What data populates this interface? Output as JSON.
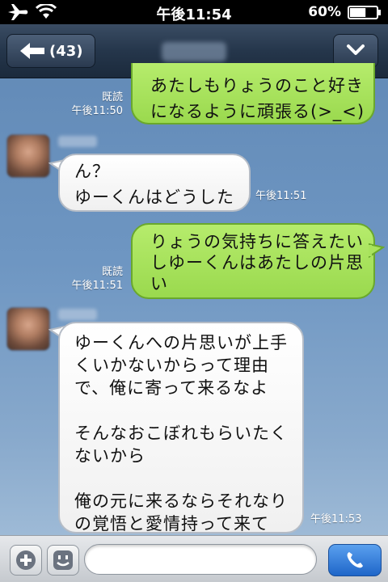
{
  "status_bar": {
    "time": "午後11:54",
    "battery_percent": "60%",
    "battery_level": 0.6
  },
  "nav": {
    "back_label": "(43)"
  },
  "messages": [
    {
      "side": "right",
      "lines": [
        "あたしもりょうのこと好き",
        "になるように頑張る(>_<)"
      ],
      "read": "既読",
      "time": "午後11:50"
    },
    {
      "side": "left",
      "lines": [
        "ん？",
        "ゆーくんはどうした"
      ],
      "time": "午後11:51"
    },
    {
      "side": "right",
      "lines": [
        "りょうの気持ちに答えたい",
        "しゆーくんはあたしの片思",
        "い"
      ],
      "read": "既読",
      "time": "午後11:51"
    },
    {
      "side": "left",
      "lines": [
        "ゆーくんへの片思いが上手",
        "くいかないからって理由",
        "で、俺に寄って来るなよ",
        "",
        "そんなおこぼれもらいたく",
        "ないから",
        "",
        "俺の元に来るならそれなり",
        "の覚悟と愛情持って来て"
      ],
      "time": "午後11:53"
    }
  ],
  "input": {
    "placeholder": ""
  },
  "colors": {
    "sent_bubble": "#a8e35c",
    "received_bubble": "#ffffff",
    "nav_bar": "#25364b",
    "call_button": "#2a72d6"
  },
  "icons": [
    "airplane-icon",
    "wifi-icon",
    "battery-icon",
    "back-arrow-icon",
    "chevron-down-icon",
    "plus-icon",
    "emoji-icon",
    "phone-icon"
  ]
}
